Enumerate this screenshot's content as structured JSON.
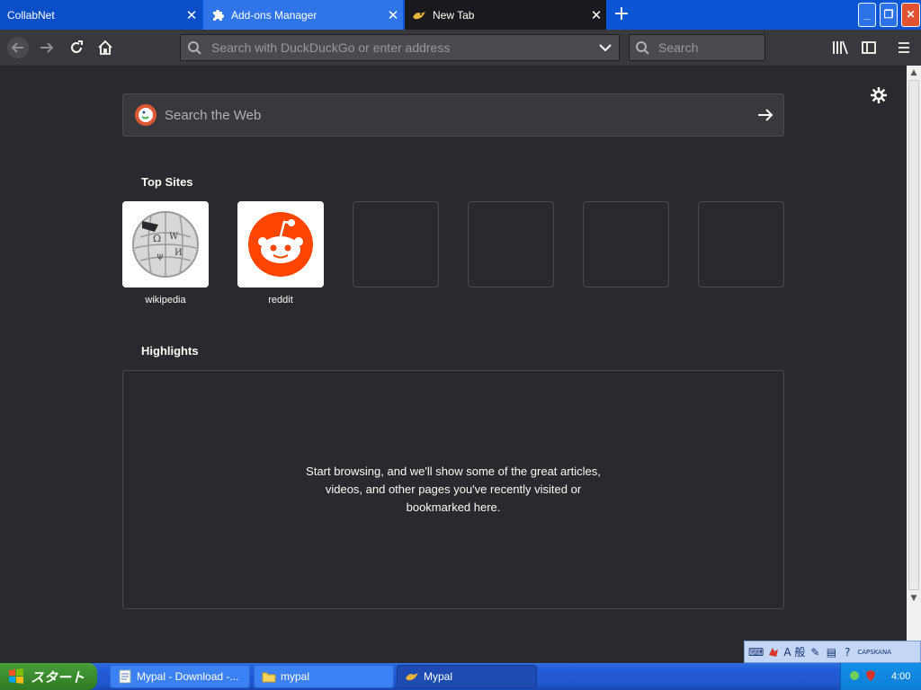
{
  "tabs": [
    {
      "title": "CollabNet",
      "icon": "none",
      "active": false
    },
    {
      "title": "Add-ons Manager",
      "icon": "puzzle-icon",
      "active": false
    },
    {
      "title": "New Tab",
      "icon": "mypal-icon",
      "active": true
    }
  ],
  "window_controls": {
    "minimize": "_",
    "maximize": "❐",
    "close": "✕"
  },
  "navbar": {
    "url_placeholder": "Search with DuckDuckGo or enter address",
    "url_value": "",
    "search_placeholder": "Search"
  },
  "newtab": {
    "web_search_placeholder": "Search the Web",
    "top_sites_title": "Top Sites",
    "top_sites": [
      {
        "label": "wikipedia",
        "icon": "wikipedia-icon"
      },
      {
        "label": "reddit",
        "icon": "reddit-icon"
      },
      {
        "label": "",
        "icon": ""
      },
      {
        "label": "",
        "icon": ""
      },
      {
        "label": "",
        "icon": ""
      },
      {
        "label": "",
        "icon": ""
      }
    ],
    "highlights_title": "Highlights",
    "highlights_message": "Start browsing, and we'll show some of the great articles, videos, and other pages you've recently visited or bookmarked here."
  },
  "langbar": {
    "ime": "A 般",
    "caps": "CAPS",
    "kana": "KANA",
    "help": "?"
  },
  "taskbar": {
    "start_label": "スタート",
    "tasks": [
      {
        "label": "Mypal - Download -...",
        "icon": "browser-doc-icon"
      },
      {
        "label": "mypal",
        "icon": "folder-icon"
      },
      {
        "label": "Mypal",
        "icon": "mypal-icon"
      }
    ],
    "clock": "4:00"
  },
  "colors": {
    "accent": "#0c56d6",
    "page_bg": "#2a2a2e",
    "toolbar": "#38383d",
    "reddit": "#ff4500"
  }
}
